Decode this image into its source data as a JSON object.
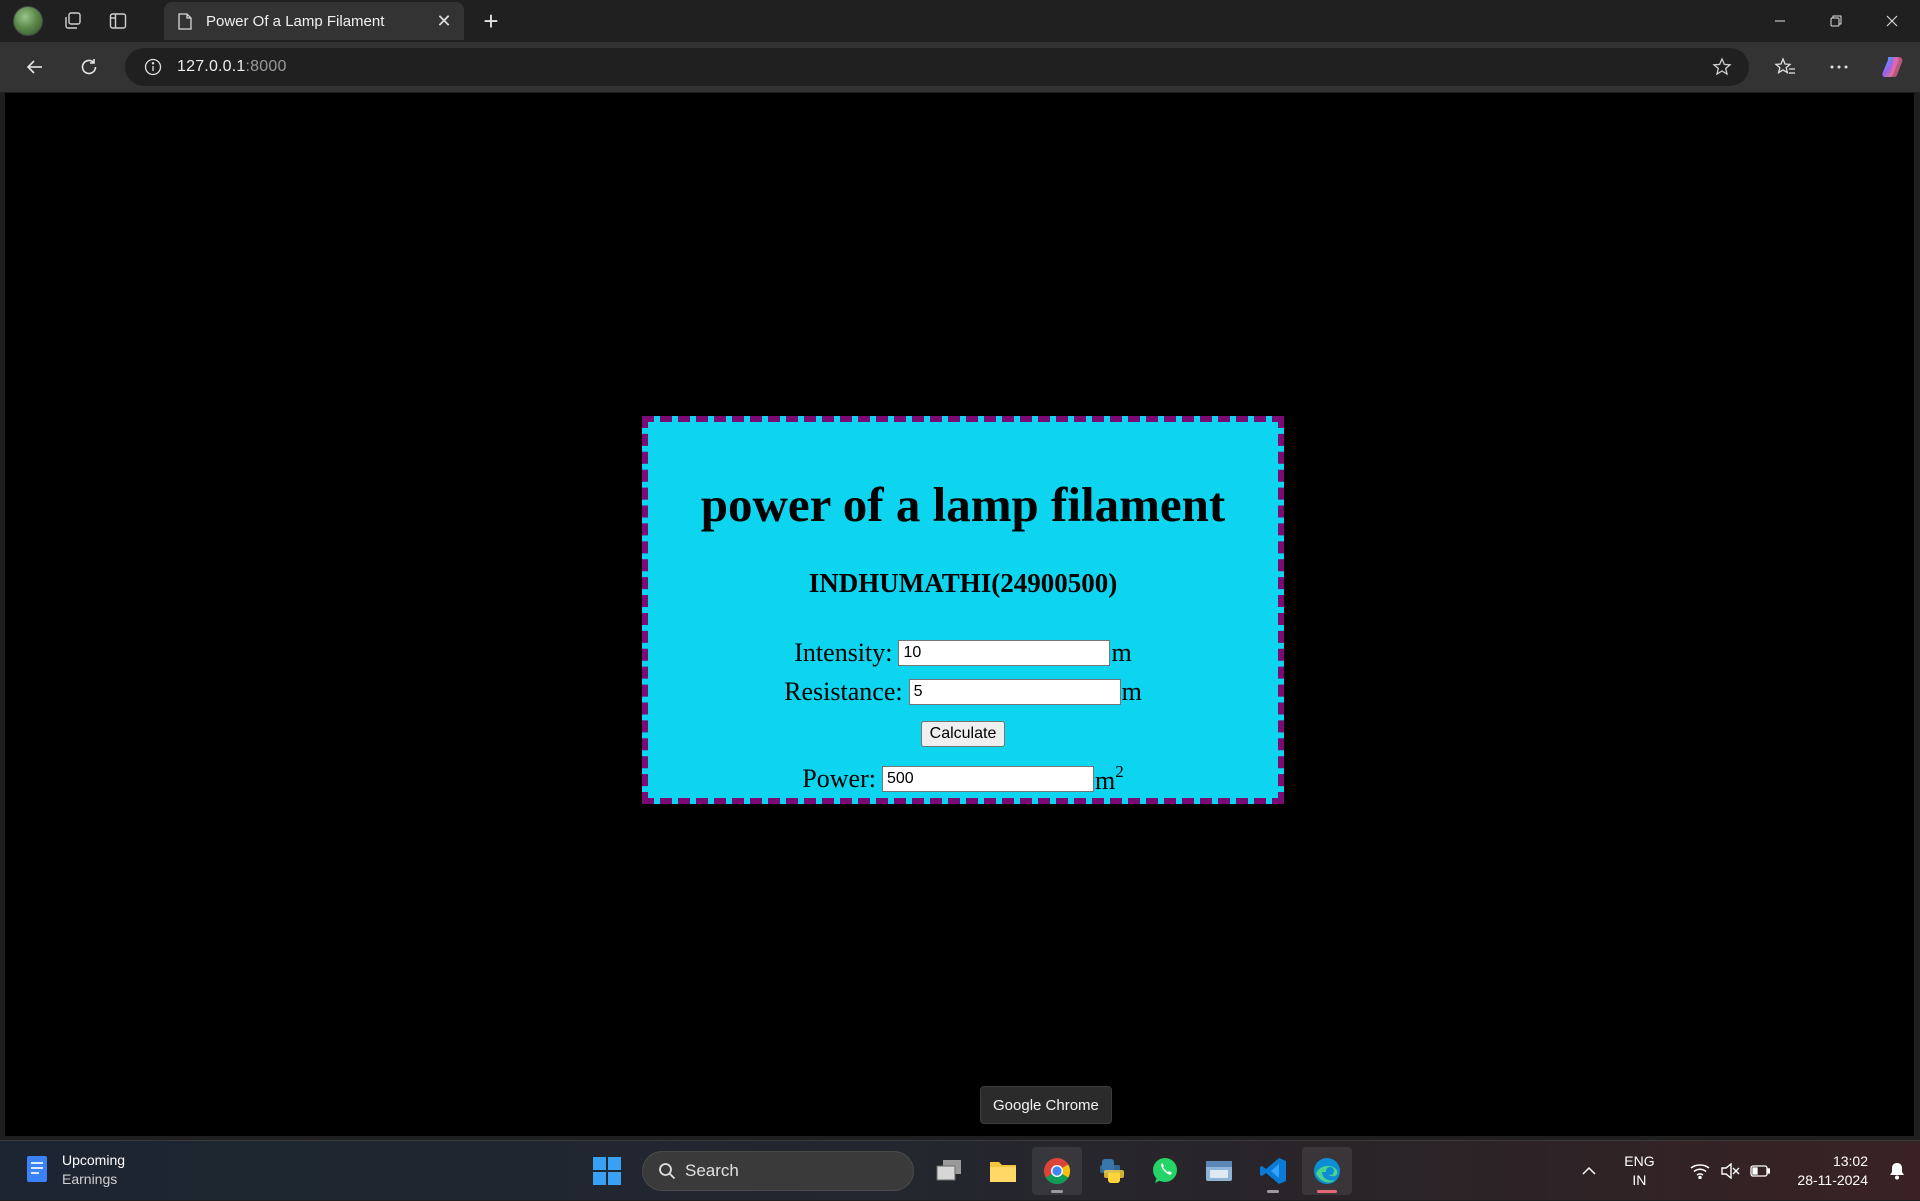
{
  "browser": {
    "tab_title": "Power Of a Lamp Filament",
    "url_host": "127.0.0.1",
    "url_port": ":8000"
  },
  "page": {
    "heading": "power of a lamp filament",
    "subheading": "INDHUMATHI(24900500)",
    "intensity_label": "Intensity:",
    "intensity_value": "10",
    "intensity_unit": "m",
    "resistance_label": "Resistance:",
    "resistance_value": "5",
    "resistance_unit": "m",
    "calculate_label": "Calculate",
    "power_label": "Power:",
    "power_value": "500",
    "power_unit": "m",
    "power_unit_exp": "2",
    "card_bg": "#0dd4ef",
    "card_border": "#7a0a74"
  },
  "tooltip": "Google Chrome",
  "taskbar": {
    "weather_title": "Upcoming",
    "weather_sub": "Earnings",
    "search_placeholder": "Search",
    "lang_top": "ENG",
    "lang_bottom": "IN",
    "time": "13:02",
    "date": "28-11-2024"
  }
}
